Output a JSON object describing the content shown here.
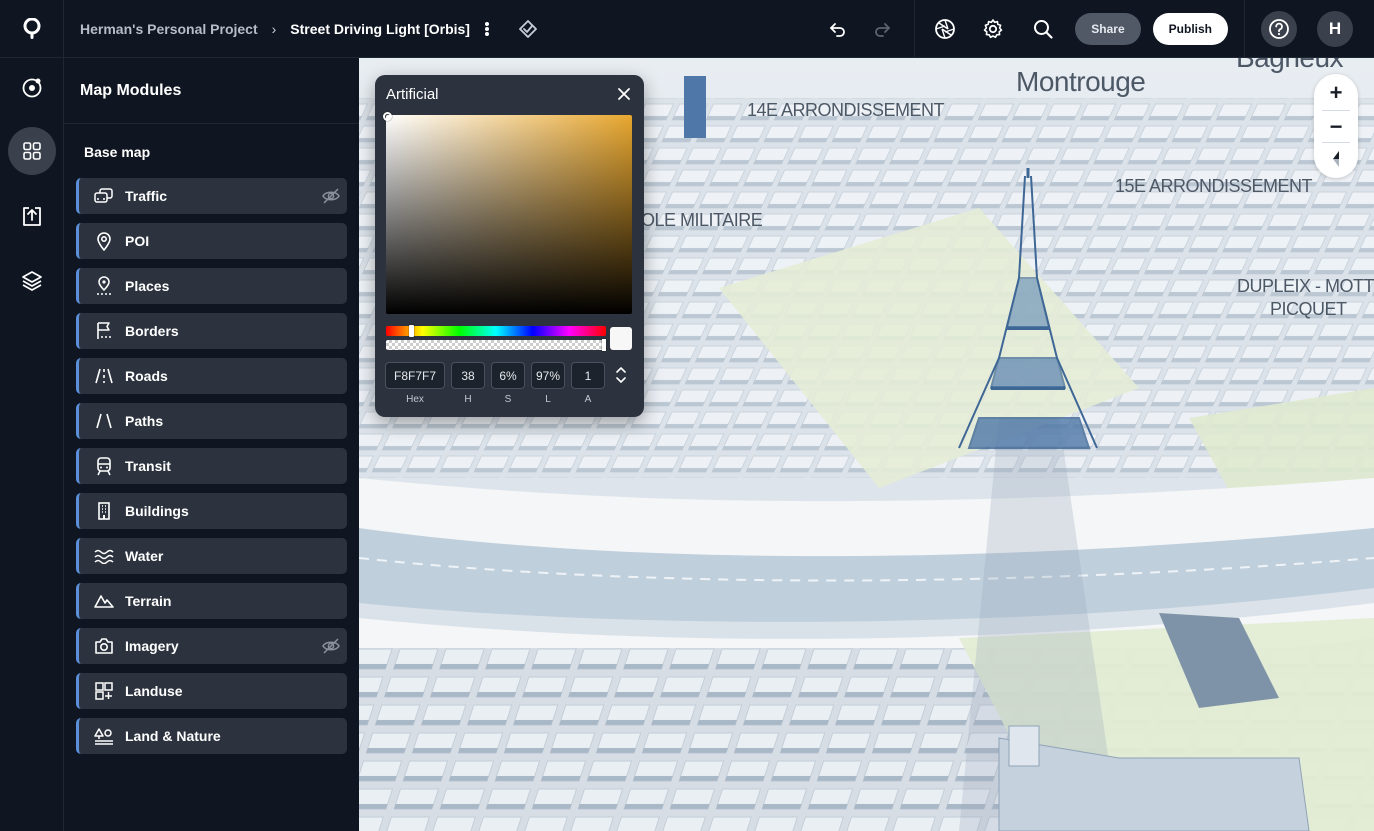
{
  "topbar": {
    "project_name": "Herman's Personal Project",
    "breadcrumb_separator": "›",
    "style_name": "Street Driving Light [Orbis]",
    "share_label": "Share",
    "publish_label": "Publish",
    "avatar_initial": "H",
    "icons": [
      "location-pin-logo-icon",
      "more-vertical-icon",
      "saved-check-icon",
      "undo-icon",
      "redo-icon",
      "aperture-icon",
      "gear-icon",
      "search-icon",
      "help-icon"
    ]
  },
  "rail": {
    "items": [
      {
        "icon": "target-icon",
        "active": false
      },
      {
        "icon": "grid-icon",
        "active": true
      },
      {
        "icon": "upload-icon",
        "active": false
      },
      {
        "icon": "layers-icon",
        "active": false
      }
    ]
  },
  "panel": {
    "title": "Map Modules",
    "section_label": "Base map",
    "modules": [
      {
        "label": "Traffic",
        "icon": "traffic-icon",
        "hidden": true
      },
      {
        "label": "POI",
        "icon": "poi-pin-icon",
        "hidden": false
      },
      {
        "label": "Places",
        "icon": "places-icon",
        "hidden": false
      },
      {
        "label": "Borders",
        "icon": "borders-icon",
        "hidden": false
      },
      {
        "label": "Roads",
        "icon": "roads-icon",
        "hidden": false
      },
      {
        "label": "Paths",
        "icon": "paths-icon",
        "hidden": false
      },
      {
        "label": "Transit",
        "icon": "transit-icon",
        "hidden": false
      },
      {
        "label": "Buildings",
        "icon": "buildings-icon",
        "hidden": false
      },
      {
        "label": "Water",
        "icon": "water-icon",
        "hidden": false
      },
      {
        "label": "Terrain",
        "icon": "terrain-icon",
        "hidden": false
      },
      {
        "label": "Imagery",
        "icon": "camera-icon",
        "hidden": true
      },
      {
        "label": "Landuse",
        "icon": "landuse-icon",
        "hidden": false
      },
      {
        "label": "Land & Nature",
        "icon": "land-nature-icon",
        "hidden": false
      }
    ]
  },
  "color_picker": {
    "title": "Artificial",
    "hex_value": "F8F7F7",
    "h_value": "38",
    "s_value": "6%",
    "l_value": "97%",
    "a_value": "1",
    "hex_label": "Hex",
    "h_label": "H",
    "s_label": "S",
    "l_label": "L",
    "a_label": "A",
    "hue_color": "#e8a72f",
    "selected_color": "#f8f7f7"
  },
  "map": {
    "labels": {
      "montrouge": "Montrouge",
      "arr14": "14E ARRONDISSEMENT",
      "bagneux": "Bagneux",
      "arr15": "15E ARRONDISSEMENT",
      "ecole": "OLE MILITAIRE",
      "dupleix_1": "DUPLEIX - MOTTE-",
      "dupleix_2": "PICQUET"
    },
    "zoom_in": "+",
    "zoom_out": "−"
  }
}
